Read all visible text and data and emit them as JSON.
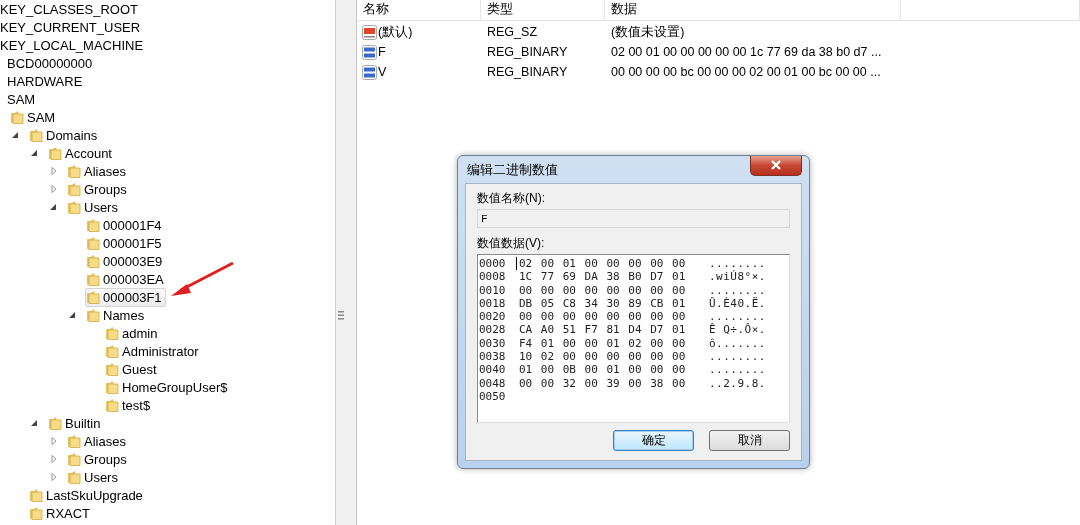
{
  "tree": [
    {
      "label": "KEY_CLASSES_ROOT",
      "selected": false
    },
    {
      "label": "KEY_CURRENT_USER",
      "selected": false
    },
    {
      "label": "KEY_LOCAL_MACHINE",
      "selected": false,
      "children": [
        {
          "label": "BCD00000000",
          "selected": false
        },
        {
          "label": "HARDWARE",
          "selected": false
        },
        {
          "label": "SAM",
          "selected": false,
          "children": [
            {
              "label": "SAM",
              "selected": false,
              "children": [
                {
                  "label": "Domains",
                  "selected": false,
                  "expanded": true,
                  "children": [
                    {
                      "label": "Account",
                      "selected": false,
                      "expanded": true,
                      "children": [
                        {
                          "label": "Aliases",
                          "selected": false,
                          "expanded": false
                        },
                        {
                          "label": "Groups",
                          "selected": false,
                          "expanded": false
                        },
                        {
                          "label": "Users",
                          "selected": false,
                          "expanded": true,
                          "children": [
                            {
                              "label": "000001F4",
                              "selected": false
                            },
                            {
                              "label": "000001F5",
                              "selected": false
                            },
                            {
                              "label": "000003E9",
                              "selected": false
                            },
                            {
                              "label": "000003EA",
                              "selected": false
                            },
                            {
                              "label": "000003F1",
                              "selected": true
                            },
                            {
                              "label": "Names",
                              "selected": false,
                              "expanded": true,
                              "children": [
                                {
                                  "label": "admin",
                                  "selected": false
                                },
                                {
                                  "label": "Administrator",
                                  "selected": false
                                },
                                {
                                  "label": "Guest",
                                  "selected": false
                                },
                                {
                                  "label": "HomeGroupUser$",
                                  "selected": false
                                },
                                {
                                  "label": "test$",
                                  "selected": false
                                }
                              ]
                            }
                          ]
                        }
                      ]
                    },
                    {
                      "label": "Builtin",
                      "selected": false,
                      "expanded": true,
                      "children": [
                        {
                          "label": "Aliases",
                          "selected": false,
                          "expanded": false
                        },
                        {
                          "label": "Groups",
                          "selected": false,
                          "expanded": false
                        },
                        {
                          "label": "Users",
                          "selected": false,
                          "expanded": false
                        }
                      ]
                    }
                  ]
                },
                {
                  "label": "LastSkuUpgrade",
                  "selected": false
                },
                {
                  "label": "RXACT",
                  "selected": false
                }
              ]
            }
          ]
        }
      ]
    }
  ],
  "values": {
    "columns": [
      "名称",
      "类型",
      "数据"
    ],
    "rows": [
      {
        "kind": "string",
        "name": "(默认)",
        "type": "REG_SZ",
        "data": "(数值未设置)"
      },
      {
        "kind": "binary",
        "name": "F",
        "type": "REG_BINARY",
        "data": "02 00 01 00 00 00 00 00 1c 77 69 da 38 b0 d7 ..."
      },
      {
        "kind": "binary",
        "name": "V",
        "type": "REG_BINARY",
        "data": "00 00 00 00 bc 00 00 00 02 00 01 00 bc 00 00 ..."
      }
    ]
  },
  "dialog": {
    "title": "编辑二进制数值",
    "name_label": "数值名称(N):",
    "name_value": "F",
    "data_label": "数值数据(V):",
    "hex_rows": [
      {
        "address": "0000",
        "bytes": "02 00 01 00 00 00 00 00",
        "ascii": "........"
      },
      {
        "address": "0008",
        "bytes": "1C 77 69 DA 38 B0 D7 01",
        "ascii": ".wiÚ8°×."
      },
      {
        "address": "0010",
        "bytes": "00 00 00 00 00 00 00 00",
        "ascii": "........"
      },
      {
        "address": "0018",
        "bytes": "DB 05 C8 34 30 89 CB 01",
        "ascii": "Û.È40.Ë."
      },
      {
        "address": "0020",
        "bytes": "00 00 00 00 00 00 00 00",
        "ascii": "........"
      },
      {
        "address": "0028",
        "bytes": "CA A0 51 F7 81 D4 D7 01",
        "ascii": "Ê Q÷.Ô×."
      },
      {
        "address": "0030",
        "bytes": "F4 01 00 00 01 02 00 00",
        "ascii": "ô......."
      },
      {
        "address": "0038",
        "bytes": "10 02 00 00 00 00 00 00",
        "ascii": "........"
      },
      {
        "address": "0040",
        "bytes": "01 00 0B 00 01 00 00 00",
        "ascii": "........"
      },
      {
        "address": "0048",
        "bytes": "00 00 32 00 39 00 38 00",
        "ascii": "..2.9.8."
      },
      {
        "address": "0050"
      }
    ],
    "buttons": [
      {
        "label": "确定",
        "default": true
      },
      {
        "label": "取消",
        "default": false
      }
    ]
  }
}
